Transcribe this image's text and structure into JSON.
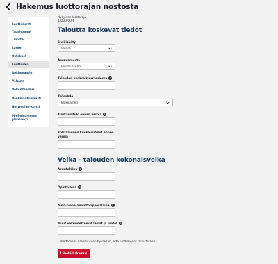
{
  "header": {
    "title": "Hakemus luottorajan nostosta",
    "back_icon": "chevron-left-icon"
  },
  "sidebar": {
    "items": [
      {
        "label": "Luottokortti"
      },
      {
        "label": "Tapahtumat"
      },
      {
        "label": "Tiliotte"
      },
      {
        "label": "Laske"
      },
      {
        "label": "Ostokset"
      },
      {
        "label": "Luottoraja"
      },
      {
        "label": "Reklamaatio"
      },
      {
        "label": "Velouta"
      },
      {
        "label": "Velouttaeduri"
      },
      {
        "label": "Pankkiautomaatti"
      },
      {
        "label": "Norwegian-kortti"
      },
      {
        "label": "Minimisummaa pienennys"
      }
    ],
    "active_index": 5
  },
  "current_limit": {
    "label": "Nykyinen luottoraja",
    "value": "1.000,00 €"
  },
  "section1": {
    "title": "Taloutta koskevat tiedot",
    "siviilisaaty": {
      "label": "Siviilisääty",
      "value": "Valitse..."
    },
    "asumismuoto": {
      "label": "Asumismuoto",
      "value": "Valitse asunto"
    },
    "vuokra": {
      "label": "Talouden vuokra kuukaudessa"
    },
    "tyosuhde": {
      "label": "Työsuhde",
      "value": "Eläkeläinen"
    },
    "kuukausitulo": {
      "label": "Kuukausitulo ennen veroja"
    },
    "kotitalous": {
      "label": "Kotitalouden kuukausitulot ennen veroja"
    }
  },
  "section2": {
    "title": "Velka - talouden kokonaisvelka",
    "asuntolaina": {
      "label": "Asuntolaina"
    },
    "opintolaina": {
      "label": "Opintolaina"
    },
    "auto": {
      "label": "Auto-/vene-/moottoripyörälaina"
    },
    "muut": {
      "label": "Muut vakuudettomat lainat ja luotot"
    }
  },
  "consent_text": "Lähettämällä hakemuksen hyväksyn, että luottotiedot tarkistetaan",
  "submit_label": "Lähetä hakemus",
  "colors": {
    "primary_text": "#1e3a56",
    "submit_bg": "#c8102e",
    "sidebar_link": "#1e4a6b"
  }
}
